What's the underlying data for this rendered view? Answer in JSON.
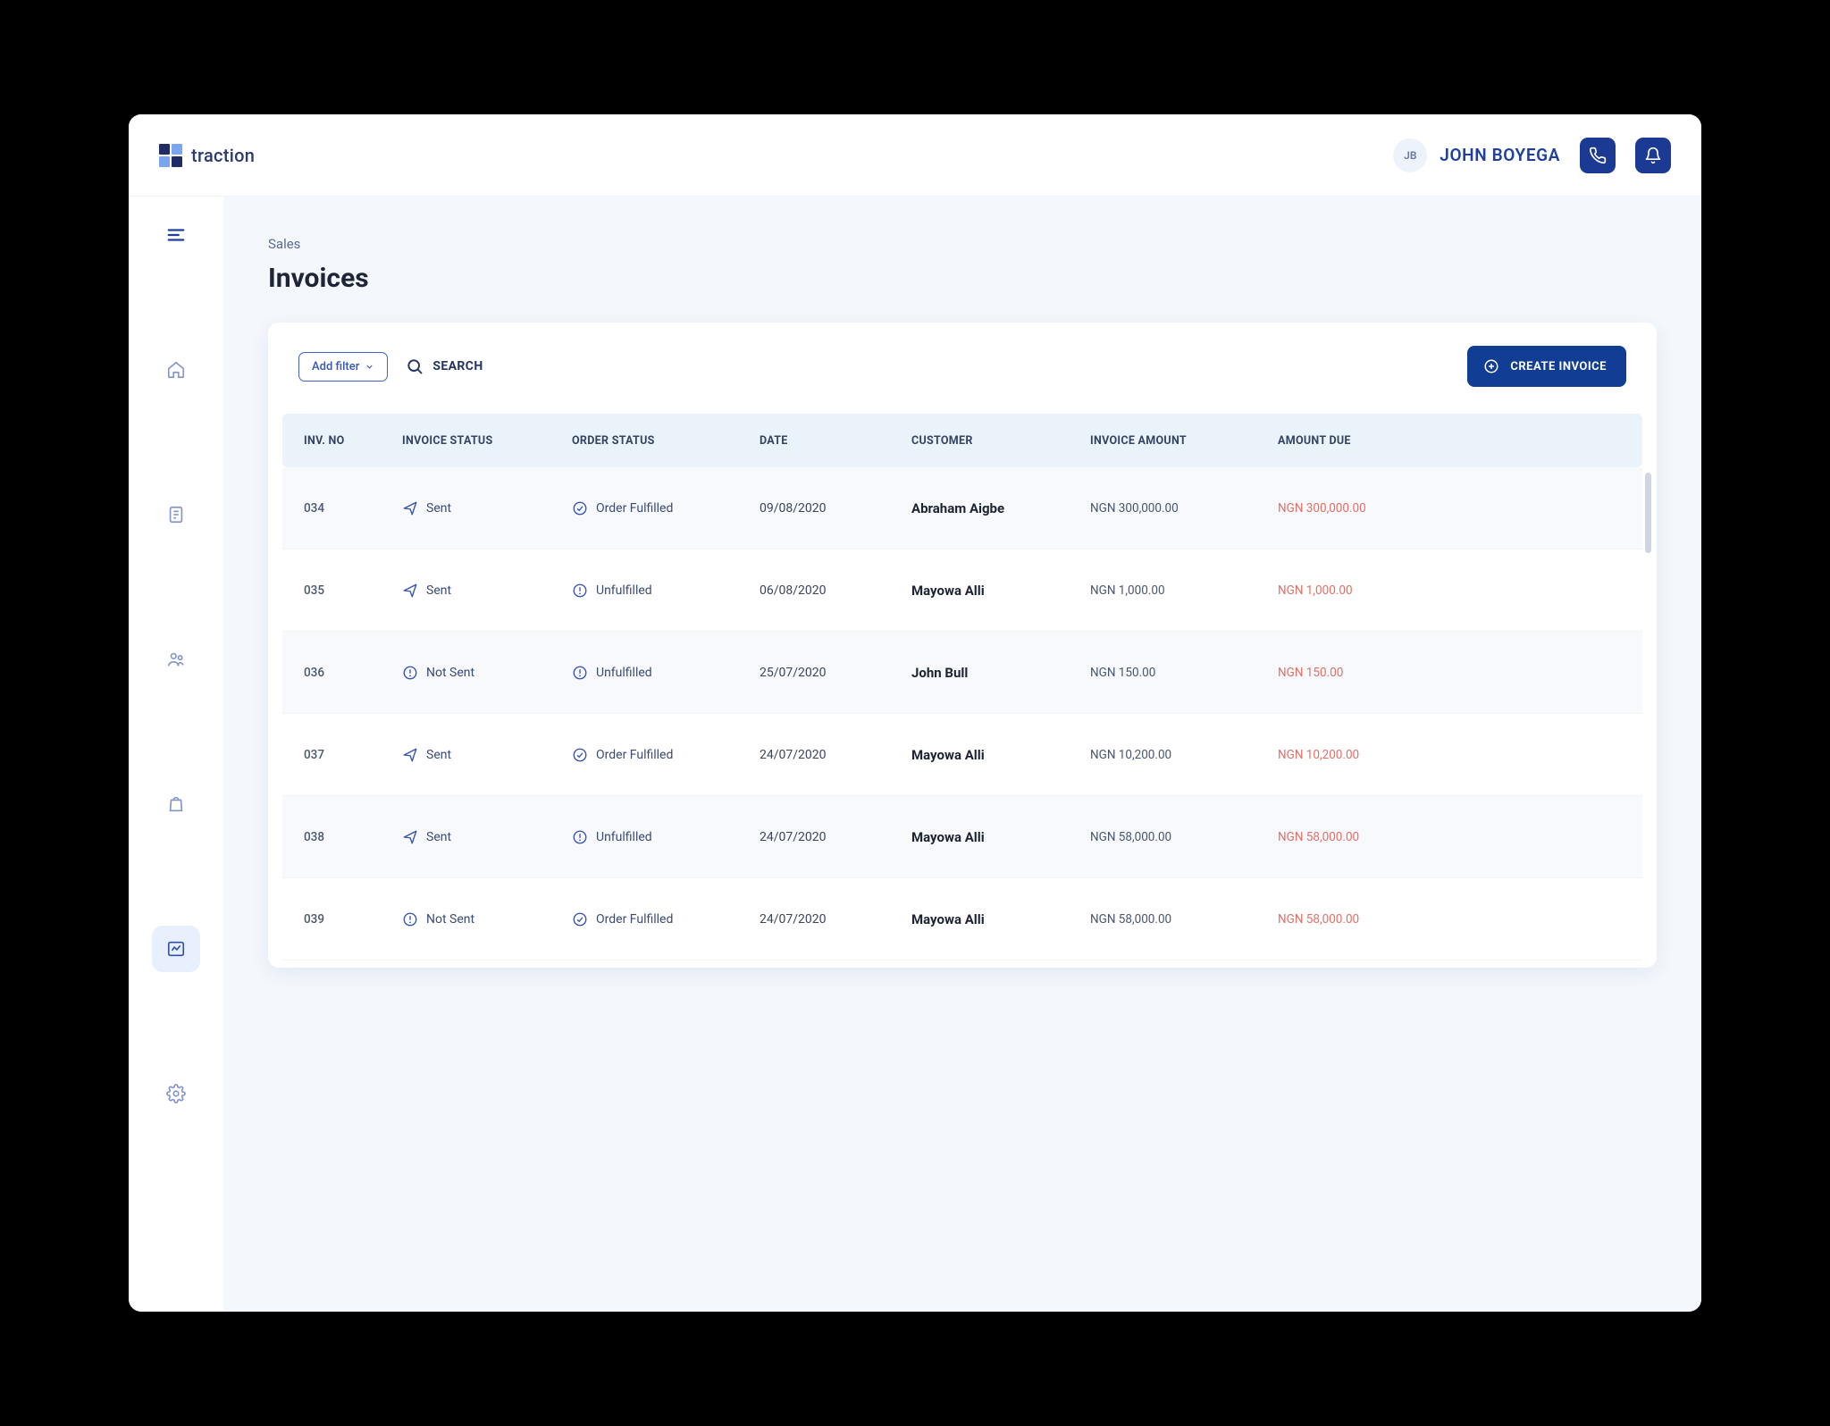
{
  "brand": {
    "name": "traction"
  },
  "header": {
    "user_initials": "JB",
    "user_name": "JOHN BOYEGA"
  },
  "breadcrumb": "Sales",
  "page_title": "Invoices",
  "toolbar": {
    "add_filter_label": "Add filter",
    "search_label": "SEARCH",
    "create_label": "CREATE INVOICE"
  },
  "columns": {
    "inv_no": "INV. NO",
    "invoice_status": "INVOICE STATUS",
    "order_status": "ORDER STATUS",
    "date": "DATE",
    "customer": "CUSTOMER",
    "invoice_amount": "INVOICE AMOUNT",
    "amount_due": "AMOUNT DUE"
  },
  "rows": [
    {
      "inv_no": "034",
      "inv_status": "Sent",
      "inv_status_icon": "sent",
      "order_status": "Order Fulfilled",
      "order_icon": "check",
      "date": "09/08/2020",
      "customer": "Abraham Aigbe",
      "amount": "NGN 300,000.00",
      "due": "NGN 300,000.00"
    },
    {
      "inv_no": "035",
      "inv_status": "Sent",
      "inv_status_icon": "sent",
      "order_status": "Unfulfilled",
      "order_icon": "alert",
      "date": "06/08/2020",
      "customer": "Mayowa Alli",
      "amount": "NGN 1,000.00",
      "due": "NGN 1,000.00"
    },
    {
      "inv_no": "036",
      "inv_status": "Not Sent",
      "inv_status_icon": "notsent",
      "order_status": "Unfulfilled",
      "order_icon": "alert",
      "date": "25/07/2020",
      "customer": "John Bull",
      "amount": "NGN 150.00",
      "due": "NGN 150.00"
    },
    {
      "inv_no": "037",
      "inv_status": "Sent",
      "inv_status_icon": "sent",
      "order_status": "Order Fulfilled",
      "order_icon": "check",
      "date": "24/07/2020",
      "customer": "Mayowa Alli",
      "amount": "NGN 10,200.00",
      "due": "NGN 10,200.00"
    },
    {
      "inv_no": "038",
      "inv_status": "Sent",
      "inv_status_icon": "sent",
      "order_status": "Unfulfilled",
      "order_icon": "alert",
      "date": "24/07/2020",
      "customer": "Mayowa Alli",
      "amount": "NGN 58,000.00",
      "due": "NGN 58,000.00"
    },
    {
      "inv_no": "039",
      "inv_status": "Not Sent",
      "inv_status_icon": "notsent",
      "order_status": "Order Fulfilled",
      "order_icon": "check",
      "date": "24/07/2020",
      "customer": "Mayowa Alli",
      "amount": "NGN 58,000.00",
      "due": "NGN 58,000.00"
    }
  ]
}
